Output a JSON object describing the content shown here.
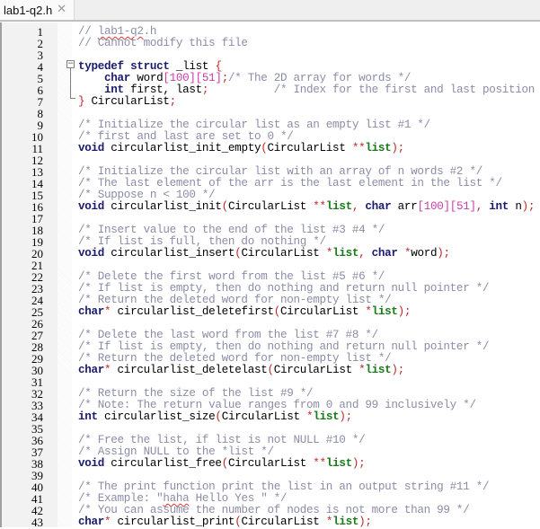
{
  "tab": {
    "title": "lab1-q2.h",
    "close_icon": "close-icon"
  },
  "colors": {
    "keyword": "#1a1a6e",
    "comment": "#8c8ca8",
    "operator": "#c0282a",
    "number": "#c83fa8",
    "parameter": "#1a7a1a"
  },
  "lines": [
    {
      "n": "1",
      "tokens": [
        [
          "cm",
          "// "
        ],
        [
          "cmsq",
          "lab1-q2"
        ],
        [
          "cm",
          ".h"
        ]
      ]
    },
    {
      "n": "2",
      "tokens": [
        [
          "cm",
          "// Cannot modify this file"
        ]
      ]
    },
    {
      "n": "3",
      "tokens": []
    },
    {
      "n": "4",
      "tokens": [
        [
          "kw",
          "typedef"
        ],
        [
          "t",
          " "
        ],
        [
          "kw",
          "struct"
        ],
        [
          "t",
          " _list "
        ],
        [
          "op",
          "{"
        ]
      ]
    },
    {
      "n": "5",
      "tokens": [
        [
          "t",
          "    "
        ],
        [
          "kw",
          "char"
        ],
        [
          "t",
          " word"
        ],
        [
          "num",
          "[100][51]"
        ],
        [
          "op",
          ";"
        ],
        [
          "cm",
          "/* The 2D array for words */"
        ]
      ]
    },
    {
      "n": "6",
      "tokens": [
        [
          "t",
          "    "
        ],
        [
          "kw",
          "int"
        ],
        [
          "t",
          " first, last"
        ],
        [
          "op",
          ";"
        ],
        [
          "cm",
          "          /* Index for the first and last position */"
        ]
      ]
    },
    {
      "n": "7",
      "tokens": [
        [
          "op",
          "}"
        ],
        [
          "t",
          " CircularList"
        ],
        [
          "op",
          ";"
        ]
      ]
    },
    {
      "n": "8",
      "tokens": []
    },
    {
      "n": "9",
      "tokens": [
        [
          "cm",
          "/* Initialize the circular list as an empty list #1 */"
        ]
      ]
    },
    {
      "n": "10",
      "tokens": [
        [
          "cm",
          "/* first and last are set to 0 */"
        ]
      ]
    },
    {
      "n": "11",
      "tokens": [
        [
          "kw",
          "void"
        ],
        [
          "t",
          " circularlist_init_empty"
        ],
        [
          "op",
          "("
        ],
        [
          "t",
          "CircularList "
        ],
        [
          "op",
          "**"
        ],
        [
          "param",
          "list"
        ],
        [
          "op",
          ")"
        ],
        [
          "op",
          ";"
        ]
      ]
    },
    {
      "n": "12",
      "tokens": []
    },
    {
      "n": "13",
      "tokens": [
        [
          "cm",
          "/* Initialize the circular list with an array of n words #2 */"
        ]
      ]
    },
    {
      "n": "14",
      "tokens": [
        [
          "cm",
          "/* The last element of the arr is the last element in the list */"
        ]
      ]
    },
    {
      "n": "15",
      "tokens": [
        [
          "cm",
          "/* Suppose n < 100 */"
        ]
      ]
    },
    {
      "n": "16",
      "tokens": [
        [
          "kw",
          "void"
        ],
        [
          "t",
          " circularlist_init"
        ],
        [
          "op",
          "("
        ],
        [
          "t",
          "CircularList "
        ],
        [
          "op",
          "**"
        ],
        [
          "param",
          "list"
        ],
        [
          "op",
          ","
        ],
        [
          "t",
          " "
        ],
        [
          "kw",
          "char"
        ],
        [
          "t",
          " arr"
        ],
        [
          "num",
          "[100][51]"
        ],
        [
          "op",
          ","
        ],
        [
          "t",
          " "
        ],
        [
          "kw",
          "int"
        ],
        [
          "t",
          " n"
        ],
        [
          "op",
          ")"
        ],
        [
          "op",
          ";"
        ]
      ]
    },
    {
      "n": "17",
      "tokens": []
    },
    {
      "n": "18",
      "tokens": [
        [
          "cm",
          "/* Insert value to the end of the list #3 #4 */"
        ]
      ]
    },
    {
      "n": "19",
      "tokens": [
        [
          "cm",
          "/* If list is full, then do nothing */"
        ]
      ]
    },
    {
      "n": "20",
      "tokens": [
        [
          "kw",
          "void"
        ],
        [
          "t",
          " circularlist_insert"
        ],
        [
          "op",
          "("
        ],
        [
          "t",
          "CircularList "
        ],
        [
          "op",
          "*"
        ],
        [
          "param",
          "list"
        ],
        [
          "op",
          ","
        ],
        [
          "t",
          " "
        ],
        [
          "kw",
          "char"
        ],
        [
          "t",
          " "
        ],
        [
          "op",
          "*"
        ],
        [
          "t",
          "word"
        ],
        [
          "op",
          ")"
        ],
        [
          "op",
          ";"
        ]
      ]
    },
    {
      "n": "21",
      "tokens": []
    },
    {
      "n": "22",
      "tokens": [
        [
          "cm",
          "/* Delete the first word from the list #5 #6 */"
        ]
      ]
    },
    {
      "n": "23",
      "tokens": [
        [
          "cm",
          "/* If list is empty, then do nothing and return null pointer */"
        ]
      ]
    },
    {
      "n": "24",
      "tokens": [
        [
          "cm",
          "/* Return the deleted word for non-empty list */"
        ]
      ]
    },
    {
      "n": "25",
      "tokens": [
        [
          "kw",
          "char"
        ],
        [
          "op",
          "*"
        ],
        [
          "t",
          " circularlist_deletefirst"
        ],
        [
          "op",
          "("
        ],
        [
          "t",
          "CircularList "
        ],
        [
          "op",
          "*"
        ],
        [
          "param",
          "list"
        ],
        [
          "op",
          ")"
        ],
        [
          "op",
          ";"
        ]
      ]
    },
    {
      "n": "26",
      "tokens": []
    },
    {
      "n": "27",
      "tokens": [
        [
          "cm",
          "/* Delete the last word from the list #7 #8 */"
        ]
      ]
    },
    {
      "n": "28",
      "tokens": [
        [
          "cm",
          "/* If list is empty, then do nothing and return null pointer */"
        ]
      ]
    },
    {
      "n": "29",
      "tokens": [
        [
          "cm",
          "/* Return the deleted word for non-empty list */"
        ]
      ]
    },
    {
      "n": "30",
      "tokens": [
        [
          "kw",
          "char"
        ],
        [
          "op",
          "*"
        ],
        [
          "t",
          " circularlist_deletelast"
        ],
        [
          "op",
          "("
        ],
        [
          "t",
          "CircularList "
        ],
        [
          "op",
          "*"
        ],
        [
          "param",
          "list"
        ],
        [
          "op",
          ")"
        ],
        [
          "op",
          ";"
        ]
      ]
    },
    {
      "n": "31",
      "tokens": []
    },
    {
      "n": "32",
      "tokens": [
        [
          "cm",
          "/* Return the size of the list #9 */"
        ]
      ]
    },
    {
      "n": "33",
      "tokens": [
        [
          "cm",
          "/* Note: The return value ranges from 0 and 99 inclusively */"
        ]
      ]
    },
    {
      "n": "34",
      "tokens": [
        [
          "kw",
          "int"
        ],
        [
          "t",
          " circularlist_size"
        ],
        [
          "op",
          "("
        ],
        [
          "t",
          "CircularList "
        ],
        [
          "op",
          "*"
        ],
        [
          "param",
          "list"
        ],
        [
          "op",
          ")"
        ],
        [
          "op",
          ";"
        ]
      ]
    },
    {
      "n": "35",
      "tokens": []
    },
    {
      "n": "36",
      "tokens": [
        [
          "cm",
          "/* Free the list, if list is not NULL #10 */"
        ]
      ]
    },
    {
      "n": "37",
      "tokens": [
        [
          "cm",
          "/* Assign NULL to the *list */"
        ]
      ]
    },
    {
      "n": "38",
      "tokens": [
        [
          "kw",
          "void"
        ],
        [
          "t",
          " circularlist_free"
        ],
        [
          "op",
          "("
        ],
        [
          "t",
          "CircularList "
        ],
        [
          "op",
          "**"
        ],
        [
          "param",
          "list"
        ],
        [
          "op",
          ")"
        ],
        [
          "op",
          ";"
        ]
      ]
    },
    {
      "n": "39",
      "tokens": []
    },
    {
      "n": "40",
      "tokens": [
        [
          "cm",
          "/* The print function print the list in an output string #11 */"
        ]
      ]
    },
    {
      "n": "41",
      "tokens": [
        [
          "cm",
          "/* Example: \""
        ],
        [
          "cmsq",
          "haha"
        ],
        [
          "cm",
          " Hello Yes \" */"
        ]
      ]
    },
    {
      "n": "42",
      "tokens": [
        [
          "cm",
          "/* You can assume the number of nodes is not more than 99 */"
        ]
      ]
    },
    {
      "n": "43",
      "tokens": [
        [
          "kw",
          "char"
        ],
        [
          "op",
          "*"
        ],
        [
          "t",
          " circularlist_print"
        ],
        [
          "op",
          "("
        ],
        [
          "t",
          "CircularList "
        ],
        [
          "op",
          "*"
        ],
        [
          "param",
          "list"
        ],
        [
          "op",
          ")"
        ],
        [
          "op",
          ";"
        ]
      ]
    }
  ]
}
